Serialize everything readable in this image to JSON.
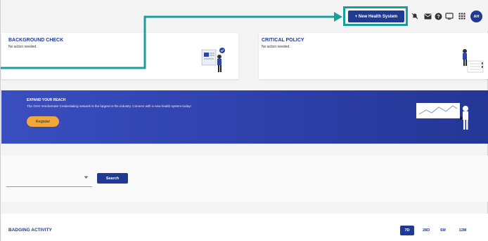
{
  "header": {
    "new_health_system_label": "+ New Health System",
    "avatar_initials": "AH",
    "icons": [
      "notifications-muted-icon",
      "mail-icon",
      "help-icon",
      "screen-icon",
      "apps-grid-icon"
    ]
  },
  "cards": [
    {
      "title": "BACKGROUND CHECK",
      "subtitle": "No action needed."
    },
    {
      "title": "CRITICAL POLICY",
      "subtitle": "No action needed."
    }
  ],
  "banner": {
    "title": "EXPAND YOUR REACH",
    "description": "The GHX Vendormate Credentialing network is the largest in the industry. Connect with a new health system today!",
    "register_label": "Register"
  },
  "search": {
    "button_label": "Search"
  },
  "badging": {
    "title": "BADGING ACTIVITY",
    "ranges": [
      "7D",
      "28D",
      "6M",
      "12M"
    ],
    "active_range": "7D"
  },
  "colors": {
    "brand": "#1f3a93",
    "highlight": "#1a9e9a",
    "register": "#f0a83c"
  }
}
